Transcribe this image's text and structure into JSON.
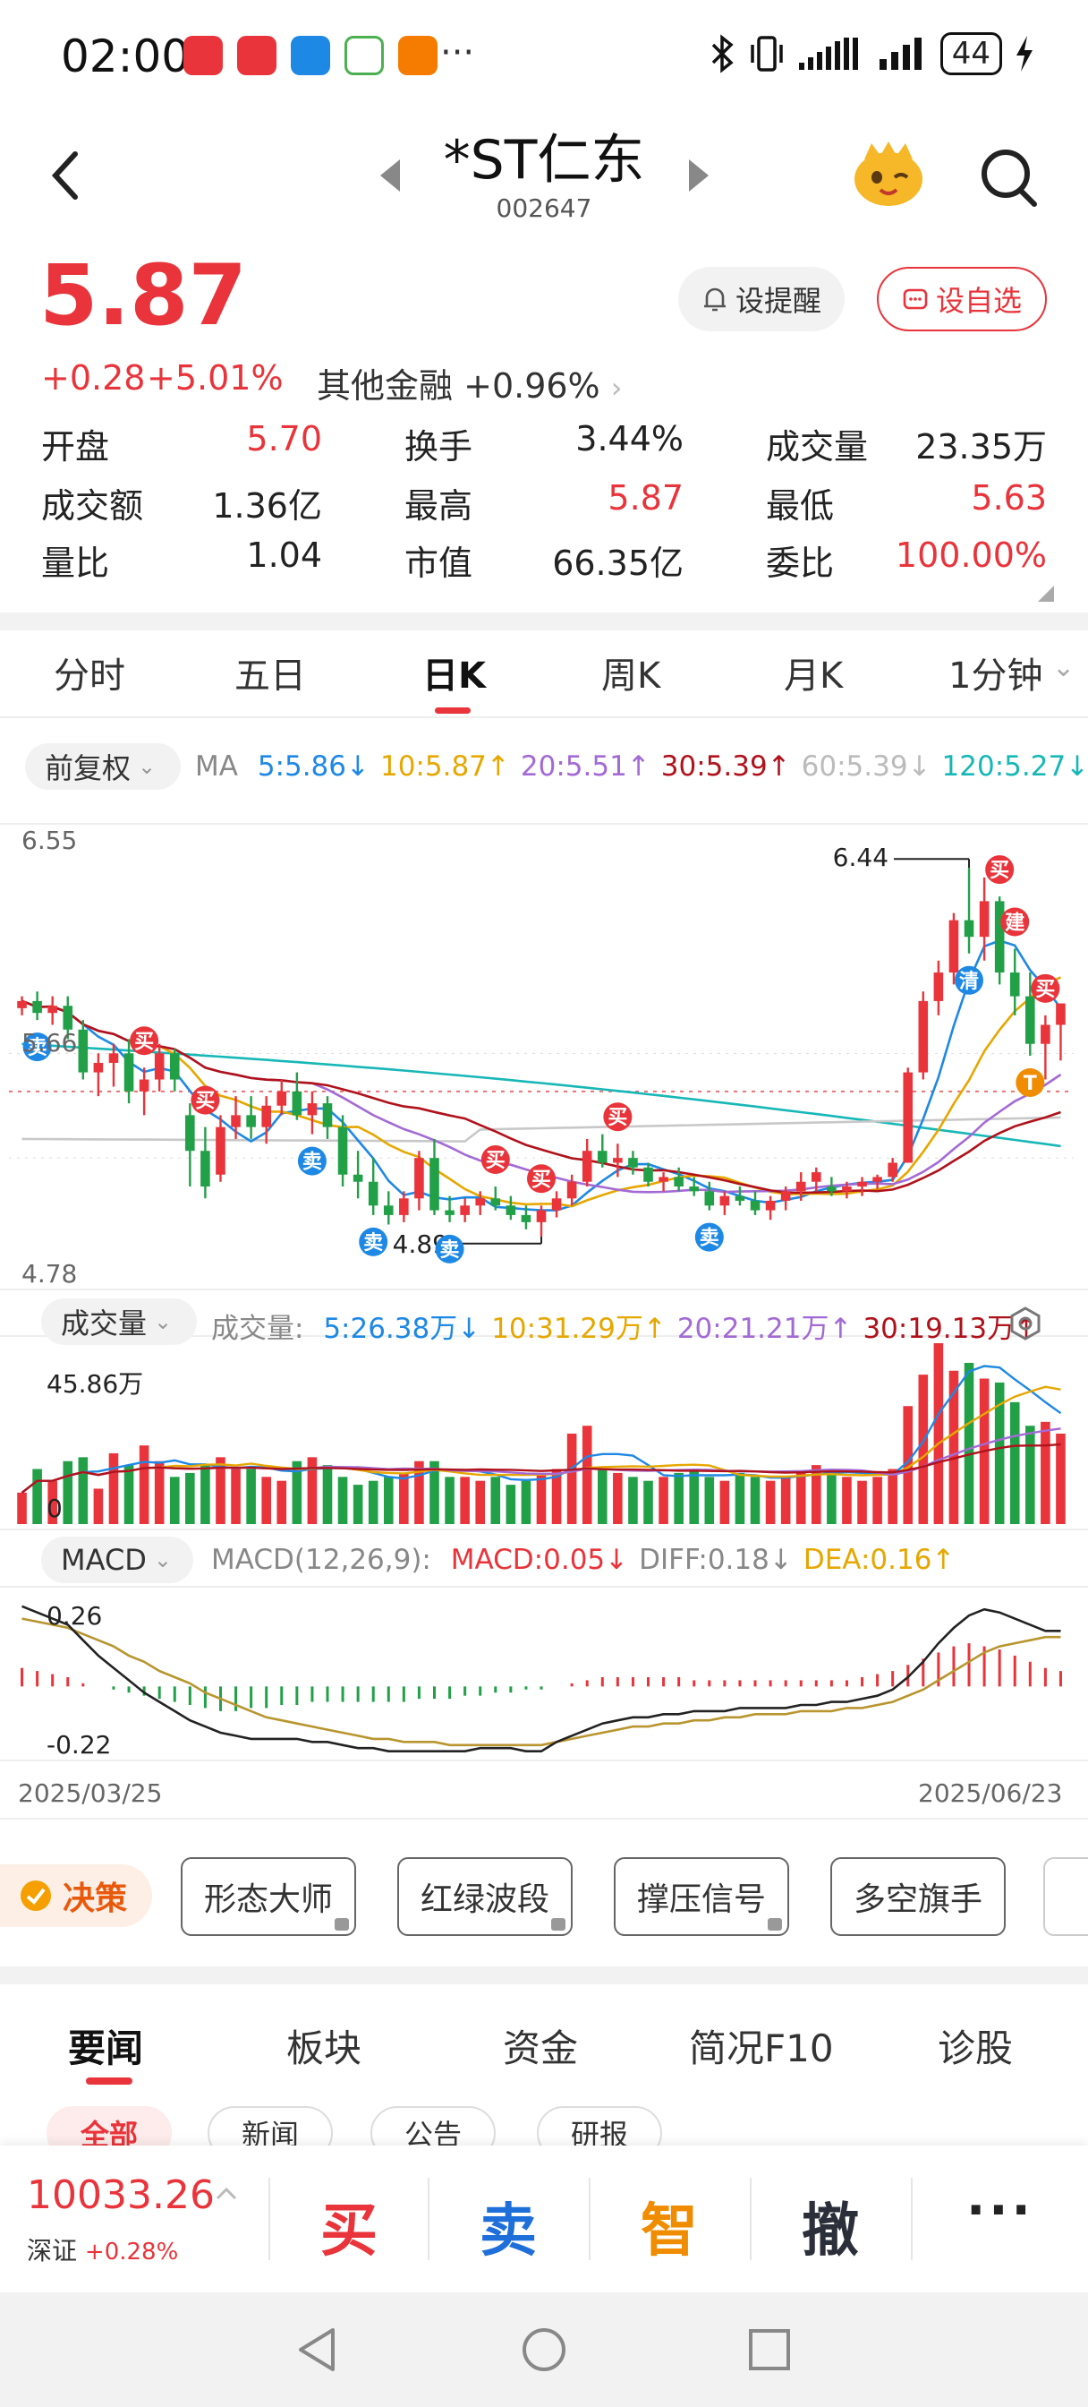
{
  "status": {
    "time": "02:00",
    "battery": "44",
    "more": "···"
  },
  "header": {
    "name": "*ST仁东",
    "code": "002647"
  },
  "quote": {
    "price": "5.87",
    "change": "+0.28",
    "change_pct": "+5.01%",
    "sector_name": "其他金融",
    "sector_pct": "+0.96%",
    "remind_label": "设提醒",
    "fav_label": "设自选",
    "stats": [
      {
        "k": "开盘",
        "v": "5.70",
        "red": true
      },
      {
        "k": "换手",
        "v": "3.44%",
        "red": false
      },
      {
        "k": "成交量",
        "v": "23.35万",
        "red": false
      },
      {
        "k": "成交额",
        "v": "1.36亿",
        "red": false
      },
      {
        "k": "最高",
        "v": "5.87",
        "red": true
      },
      {
        "k": "最低",
        "v": "5.63",
        "red": true
      },
      {
        "k": "量比",
        "v": "1.04",
        "red": false
      },
      {
        "k": "市值",
        "v": "66.35亿",
        "red": false
      },
      {
        "k": "委比",
        "v": "100.00%",
        "red": true
      }
    ]
  },
  "period_tabs": [
    "分时",
    "五日",
    "日K",
    "周K",
    "月K",
    "1分钟"
  ],
  "active_period": "日K",
  "indicators": {
    "adjust": "前复权",
    "ma_label": "MA",
    "ma": [
      {
        "text": "5:5.86↓",
        "color": "#1e88e5"
      },
      {
        "text": "10:5.87↑",
        "color": "#e6a700"
      },
      {
        "text": "20:5.51↑",
        "color": "#a36ad6"
      },
      {
        "text": "30:5.39↑",
        "color": "#b0121b"
      },
      {
        "text": "60:5.39↓",
        "color": "#bbbbbb"
      },
      {
        "text": "120:5.27↓",
        "color": "#18b7b7"
      }
    ],
    "vol_chip": "成交量",
    "vol_label": "成交量:",
    "vol": [
      {
        "text": "5:26.38万↓",
        "color": "#1e88e5"
      },
      {
        "text": "10:31.29万↑",
        "color": "#e6a700"
      },
      {
        "text": "20:21.21万↑",
        "color": "#a36ad6"
      },
      {
        "text": "30:19.13万↑",
        "color": "#b0121b"
      }
    ],
    "macd_chip": "MACD",
    "macd_params": "MACD(12,26,9):",
    "macd": [
      {
        "text": "MACD:0.05↓",
        "color": "#e8343a"
      },
      {
        "text": "DIFF:0.18↓",
        "color": "#888888"
      },
      {
        "text": "DEA:0.16↑",
        "color": "#e6a700"
      }
    ]
  },
  "chart_data": {
    "type": "candlestick",
    "y_top": "6.55",
    "y_bottom": "4.78",
    "y_mid": "5.66",
    "high_label": "6.44",
    "low_label": "4.89",
    "vol_max_label": "45.86万",
    "vol_zero_label": "0",
    "macd_top": "0.26",
    "macd_bottom": "-0.22",
    "date_start": "2025/03/25",
    "date_end": "2025/06/23",
    "ylim": [
      4.78,
      6.55
    ],
    "candles": [
      [
        5.85,
        5.9,
        5.82,
        5.88
      ],
      [
        5.88,
        5.92,
        5.8,
        5.83
      ],
      [
        5.83,
        5.9,
        5.78,
        5.86
      ],
      [
        5.86,
        5.9,
        5.72,
        5.76
      ],
      [
        5.76,
        5.8,
        5.55,
        5.58
      ],
      [
        5.58,
        5.66,
        5.48,
        5.62
      ],
      [
        5.62,
        5.7,
        5.52,
        5.66
      ],
      [
        5.66,
        5.72,
        5.45,
        5.5
      ],
      [
        5.5,
        5.6,
        5.4,
        5.55
      ],
      [
        5.55,
        5.7,
        5.5,
        5.66
      ],
      [
        5.66,
        5.68,
        5.5,
        5.55
      ],
      [
        5.4,
        5.45,
        5.1,
        5.25
      ],
      [
        5.25,
        5.35,
        5.05,
        5.1
      ],
      [
        5.15,
        5.4,
        5.12,
        5.35
      ],
      [
        5.35,
        5.48,
        5.3,
        5.4
      ],
      [
        5.4,
        5.48,
        5.3,
        5.35
      ],
      [
        5.35,
        5.48,
        5.28,
        5.44
      ],
      [
        5.44,
        5.55,
        5.4,
        5.5
      ],
      [
        5.5,
        5.58,
        5.38,
        5.4
      ],
      [
        5.4,
        5.5,
        5.32,
        5.45
      ],
      [
        5.45,
        5.48,
        5.3,
        5.35
      ],
      [
        5.35,
        5.4,
        5.1,
        5.15
      ],
      [
        5.15,
        5.25,
        5.05,
        5.12
      ],
      [
        5.12,
        5.22,
        4.98,
        5.02
      ],
      [
        5.02,
        5.08,
        4.94,
        4.98
      ],
      [
        4.98,
        5.08,
        4.95,
        5.05
      ],
      [
        5.05,
        5.25,
        5.0,
        5.22
      ],
      [
        5.22,
        5.3,
        4.98,
        5.0
      ],
      [
        5.0,
        5.06,
        4.95,
        4.98
      ],
      [
        4.98,
        5.05,
        4.95,
        5.02
      ],
      [
        5.02,
        5.08,
        4.98,
        5.05
      ],
      [
        5.05,
        5.1,
        5.0,
        5.02
      ],
      [
        5.02,
        5.06,
        4.96,
        4.98
      ],
      [
        4.98,
        5.02,
        4.92,
        4.95
      ],
      [
        4.95,
        5.02,
        4.89,
        5.0
      ],
      [
        5.0,
        5.08,
        4.97,
        5.05
      ],
      [
        5.05,
        5.15,
        5.02,
        5.12
      ],
      [
        5.12,
        5.3,
        5.1,
        5.25
      ],
      [
        5.25,
        5.32,
        5.18,
        5.2
      ],
      [
        5.2,
        5.28,
        5.14,
        5.22
      ],
      [
        5.22,
        5.25,
        5.15,
        5.18
      ],
      [
        5.18,
        5.2,
        5.1,
        5.12
      ],
      [
        5.12,
        5.16,
        5.08,
        5.14
      ],
      [
        5.14,
        5.18,
        5.08,
        5.1
      ],
      [
        5.1,
        5.14,
        5.06,
        5.08
      ],
      [
        5.08,
        5.12,
        5.0,
        5.02
      ],
      [
        5.02,
        5.08,
        4.98,
        5.06
      ],
      [
        5.06,
        5.1,
        5.02,
        5.04
      ],
      [
        5.04,
        5.08,
        4.98,
        5.0
      ],
      [
        5.0,
        5.06,
        4.96,
        5.04
      ],
      [
        5.04,
        5.1,
        5.0,
        5.08
      ],
      [
        5.08,
        5.16,
        5.04,
        5.12
      ],
      [
        5.12,
        5.18,
        5.08,
        5.16
      ],
      [
        5.1,
        5.14,
        5.06,
        5.08
      ],
      [
        5.08,
        5.12,
        5.05,
        5.1
      ],
      [
        5.1,
        5.14,
        5.06,
        5.12
      ],
      [
        5.12,
        5.15,
        5.09,
        5.14
      ],
      [
        5.14,
        5.22,
        5.12,
        5.2
      ],
      [
        5.2,
        5.6,
        5.2,
        5.58
      ],
      [
        5.58,
        5.92,
        5.55,
        5.88
      ],
      [
        5.88,
        6.05,
        5.82,
        6.0
      ],
      [
        6.0,
        6.25,
        5.95,
        6.22
      ],
      [
        6.22,
        6.44,
        6.08,
        6.15
      ],
      [
        6.15,
        6.4,
        6.05,
        6.3
      ],
      [
        6.3,
        6.32,
        5.95,
        6.0
      ],
      [
        6.0,
        6.1,
        5.82,
        5.9
      ],
      [
        5.9,
        6.0,
        5.65,
        5.7
      ],
      [
        5.7,
        5.82,
        5.55,
        5.78
      ],
      [
        5.78,
        5.87,
        5.63,
        5.87
      ]
    ],
    "volumes": [
      8,
      14,
      11,
      16,
      17,
      9,
      18,
      15,
      20,
      16,
      12,
      13,
      15,
      17,
      14,
      14,
      12,
      11,
      16,
      17,
      15,
      12,
      10,
      11,
      12,
      13,
      16,
      16,
      12,
      12,
      11,
      12,
      10,
      11,
      13,
      14,
      23,
      25,
      14,
      13,
      12,
      11,
      12,
      13,
      14,
      12,
      11,
      13,
      12,
      11,
      12,
      13,
      15,
      14,
      12,
      11,
      12,
      14,
      30,
      38,
      46,
      39,
      41,
      37,
      36,
      31,
      25,
      26,
      23
    ],
    "macd_hist": [
      0.06,
      0.05,
      0.04,
      0.03,
      0.01,
      0.0,
      -0.01,
      -0.02,
      -0.03,
      -0.04,
      -0.05,
      -0.06,
      -0.07,
      -0.08,
      -0.08,
      -0.07,
      -0.07,
      -0.06,
      -0.06,
      -0.05,
      -0.05,
      -0.05,
      -0.05,
      -0.05,
      -0.05,
      -0.05,
      -0.04,
      -0.04,
      -0.04,
      -0.03,
      -0.03,
      -0.02,
      -0.02,
      -0.01,
      -0.01,
      0.0,
      0.01,
      0.02,
      0.03,
      0.03,
      0.03,
      0.03,
      0.03,
      0.03,
      0.02,
      0.02,
      0.02,
      0.02,
      0.02,
      0.02,
      0.02,
      0.02,
      0.02,
      0.02,
      0.02,
      0.03,
      0.04,
      0.05,
      0.07,
      0.09,
      0.11,
      0.13,
      0.14,
      0.13,
      0.12,
      0.1,
      0.08,
      0.06,
      0.05
    ],
    "diff": [
      0.26,
      0.24,
      0.22,
      0.2,
      0.15,
      0.1,
      0.06,
      0.02,
      -0.02,
      -0.05,
      -0.08,
      -0.11,
      -0.13,
      -0.15,
      -0.16,
      -0.17,
      -0.17,
      -0.17,
      -0.17,
      -0.18,
      -0.18,
      -0.19,
      -0.2,
      -0.2,
      -0.21,
      -0.21,
      -0.21,
      -0.21,
      -0.21,
      -0.21,
      -0.2,
      -0.2,
      -0.2,
      -0.21,
      -0.21,
      -0.18,
      -0.16,
      -0.14,
      -0.12,
      -0.11,
      -0.1,
      -0.1,
      -0.09,
      -0.09,
      -0.08,
      -0.08,
      -0.08,
      -0.07,
      -0.07,
      -0.07,
      -0.07,
      -0.06,
      -0.06,
      -0.05,
      -0.05,
      -0.04,
      -0.03,
      -0.01,
      0.03,
      0.08,
      0.14,
      0.19,
      0.23,
      0.25,
      0.24,
      0.22,
      0.2,
      0.18,
      0.18
    ],
    "dea": [
      0.22,
      0.21,
      0.2,
      0.19,
      0.17,
      0.15,
      0.13,
      0.1,
      0.08,
      0.05,
      0.03,
      0.01,
      -0.02,
      -0.04,
      -0.06,
      -0.08,
      -0.1,
      -0.11,
      -0.12,
      -0.13,
      -0.14,
      -0.15,
      -0.16,
      -0.17,
      -0.17,
      -0.18,
      -0.18,
      -0.18,
      -0.19,
      -0.19,
      -0.19,
      -0.19,
      -0.19,
      -0.19,
      -0.19,
      -0.18,
      -0.17,
      -0.16,
      -0.15,
      -0.14,
      -0.13,
      -0.13,
      -0.12,
      -0.12,
      -0.11,
      -0.11,
      -0.1,
      -0.1,
      -0.09,
      -0.09,
      -0.09,
      -0.08,
      -0.08,
      -0.08,
      -0.07,
      -0.07,
      -0.06,
      -0.05,
      -0.03,
      -0.01,
      0.02,
      0.05,
      0.08,
      0.11,
      0.13,
      0.14,
      0.15,
      0.16,
      0.16
    ],
    "signals": [
      {
        "i": 1,
        "type": "卖"
      },
      {
        "i": 8,
        "type": "买"
      },
      {
        "i": 12,
        "type": "买"
      },
      {
        "i": 19,
        "type": "卖"
      },
      {
        "i": 23,
        "type": "卖"
      },
      {
        "i": 28,
        "type": "卖"
      },
      {
        "i": 31,
        "type": "买"
      },
      {
        "i": 34,
        "type": "买"
      },
      {
        "i": 39,
        "type": "买"
      },
      {
        "i": 45,
        "type": "卖"
      },
      {
        "i": 62,
        "type": "清"
      },
      {
        "i": 64,
        "type": "买"
      },
      {
        "i": 66,
        "type": "T"
      },
      {
        "i": 67,
        "type": "买"
      },
      {
        "i": 65,
        "type": "建"
      }
    ]
  },
  "tools": {
    "decision": "决策",
    "tags": [
      "形态大师",
      "红绿波段",
      "撑压信号",
      "多空旗手"
    ]
  },
  "news": {
    "tabs": [
      "要闻",
      "板块",
      "资金",
      "简况F10",
      "诊股"
    ],
    "chips": [
      "全部",
      "新闻",
      "公告",
      "研报"
    ]
  },
  "trade_bar": {
    "index_value": "10033.26",
    "index_name": "深证",
    "index_pct": "+0.28%",
    "buy": "买",
    "sell": "卖",
    "smart": "智",
    "cancel": "撤",
    "more": "···"
  },
  "colors": {
    "up": "#e8343a",
    "down": "#22a048",
    "accent": "#e8343a"
  }
}
